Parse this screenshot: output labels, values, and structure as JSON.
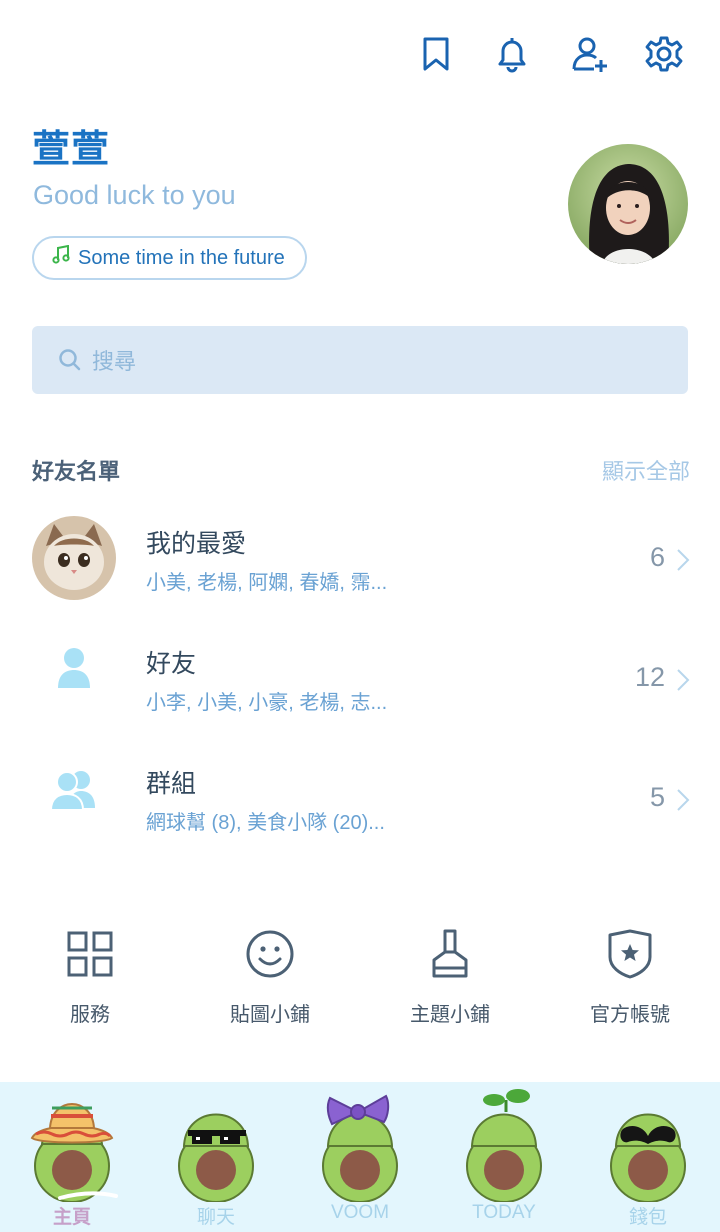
{
  "header": {
    "icons": [
      "bookmark-icon",
      "bell-icon",
      "add-friend-icon",
      "gear-icon"
    ]
  },
  "profile": {
    "name": "萱萱",
    "status_message": "Good luck to you",
    "music": "Some time in the future"
  },
  "search": {
    "placeholder": "搜尋"
  },
  "friends": {
    "title": "好友名單",
    "show_all": "顯示全部",
    "rows": [
      {
        "title": "我的最愛",
        "members": "小美, 老楊, 阿嫻, 春嬌, 霈...",
        "count": "6"
      },
      {
        "title": "好友",
        "members": "小李, 小美, 小豪, 老楊, 志...",
        "count": "12"
      },
      {
        "title": "群組",
        "members": "網球幫 (8), 美食小隊 (20)...",
        "count": "5"
      }
    ]
  },
  "services": [
    {
      "label": "服務",
      "icon": "grid-icon"
    },
    {
      "label": "貼圖小鋪",
      "icon": "smiley-icon"
    },
    {
      "label": "主題小鋪",
      "icon": "brush-icon"
    },
    {
      "label": "官方帳號",
      "icon": "shield-star-icon"
    }
  ],
  "tabs": [
    {
      "label": "主頁",
      "icon": "avocado-sombrero-icon",
      "active": true
    },
    {
      "label": "聊天",
      "icon": "avocado-sunglasses-icon",
      "active": false
    },
    {
      "label": "VOOM",
      "icon": "avocado-bow-icon",
      "active": false
    },
    {
      "label": "TODAY",
      "icon": "avocado-sprout-icon",
      "active": false
    },
    {
      "label": "錢包",
      "icon": "avocado-mustache-icon",
      "active": false
    }
  ],
  "colors": {
    "accent": "#1a73c4",
    "light_blue": "#8fb9dd",
    "search_bg": "#dbe8f5",
    "tabbar_bg": "#e3f6fd"
  }
}
